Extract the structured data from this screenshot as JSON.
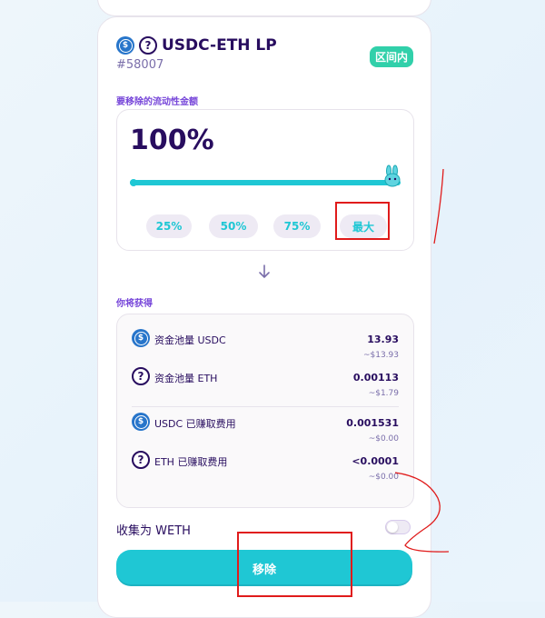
{
  "position": {
    "title": "USDC-ETH LP",
    "id": "#58007",
    "status_badge": "区间内",
    "token0_icon": "usdc-coin-icon",
    "token1_icon": "unknown-token-icon"
  },
  "remove_section": {
    "label": "要移除的流动性金额",
    "percent_display": "100%",
    "slider_value_percent": 100,
    "quick_buttons": [
      "25%",
      "50%",
      "75%",
      "最大"
    ]
  },
  "arrow_icon": "arrow-down-icon",
  "receive_section": {
    "label": "你将获得",
    "rows": [
      {
        "icon": "usdc-coin-icon",
        "label": "资金池量 USDC",
        "value": "13.93",
        "usd": "~$13.93"
      },
      {
        "icon": "unknown-token-icon",
        "label": "资金池量 ETH",
        "value": "0.00113",
        "usd": "~$1.79"
      },
      {
        "icon": "usdc-coin-icon",
        "label": "USDC 已赚取费用",
        "value": "0.001531",
        "usd": "~$0.00"
      },
      {
        "icon": "unknown-token-icon",
        "label": "ETH 已赚取费用",
        "value": "<0.0001",
        "usd": "~$0.00"
      }
    ]
  },
  "collect_weth": {
    "label": "收集为 WETH",
    "enabled": false
  },
  "action": {
    "remove_label": "移除"
  },
  "colors": {
    "primary": "#1fc7d4",
    "text": "#280d5f",
    "success": "#31d0aa",
    "annotation": "#e01b1b"
  }
}
